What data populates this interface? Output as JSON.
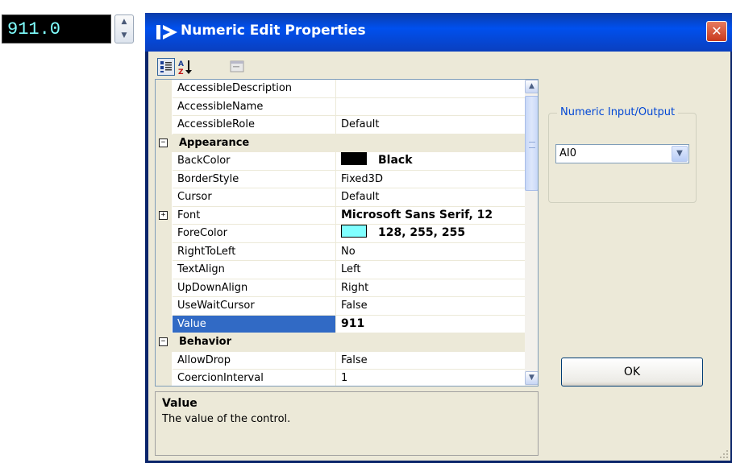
{
  "numeric_control": {
    "value": "911.0",
    "fore_color": "#80ffff",
    "back_color": "#000000"
  },
  "dialog": {
    "title": "Numeric Edit Properties",
    "close_label": "✕",
    "ok_label": "OK"
  },
  "toolbar": {
    "buttons": [
      "categorized-icon",
      "alphabetical-icon",
      "property-pages-icon"
    ]
  },
  "property_grid": {
    "rows": [
      {
        "name": "AccessibleDescription",
        "value": ""
      },
      {
        "name": "AccessibleName",
        "value": ""
      },
      {
        "name": "AccessibleRole",
        "value": "Default"
      },
      {
        "category": true,
        "name": "Appearance",
        "expander": "−"
      },
      {
        "name": "BackColor",
        "value": "Black",
        "swatch": "#000000",
        "bold": true
      },
      {
        "name": "BorderStyle",
        "value": "Fixed3D"
      },
      {
        "name": "Cursor",
        "value": "Default"
      },
      {
        "name": "Font",
        "value": "Microsoft Sans Serif, 12",
        "bold": true,
        "expander": "+"
      },
      {
        "name": "ForeColor",
        "value": "128, 255, 255",
        "swatch": "#80ffff",
        "bold": true
      },
      {
        "name": "RightToLeft",
        "value": "No"
      },
      {
        "name": "TextAlign",
        "value": "Left"
      },
      {
        "name": "UpDownAlign",
        "value": "Right"
      },
      {
        "name": "UseWaitCursor",
        "value": "False"
      },
      {
        "name": "Value",
        "value": "911",
        "bold": true,
        "selected": true
      },
      {
        "category": true,
        "name": "Behavior",
        "expander": "−"
      },
      {
        "name": "AllowDrop",
        "value": "False"
      },
      {
        "name": "CoercionInterval",
        "value": "1"
      }
    ]
  },
  "description": {
    "title": "Value",
    "text": "The value of the control."
  },
  "io_group": {
    "label": "Numeric Input/Output",
    "selected": "AI0"
  },
  "colors": {
    "title_bar": "#0050ee",
    "selection": "#316ac5",
    "client": "#ece9d8",
    "group_label": "#0046d5"
  }
}
